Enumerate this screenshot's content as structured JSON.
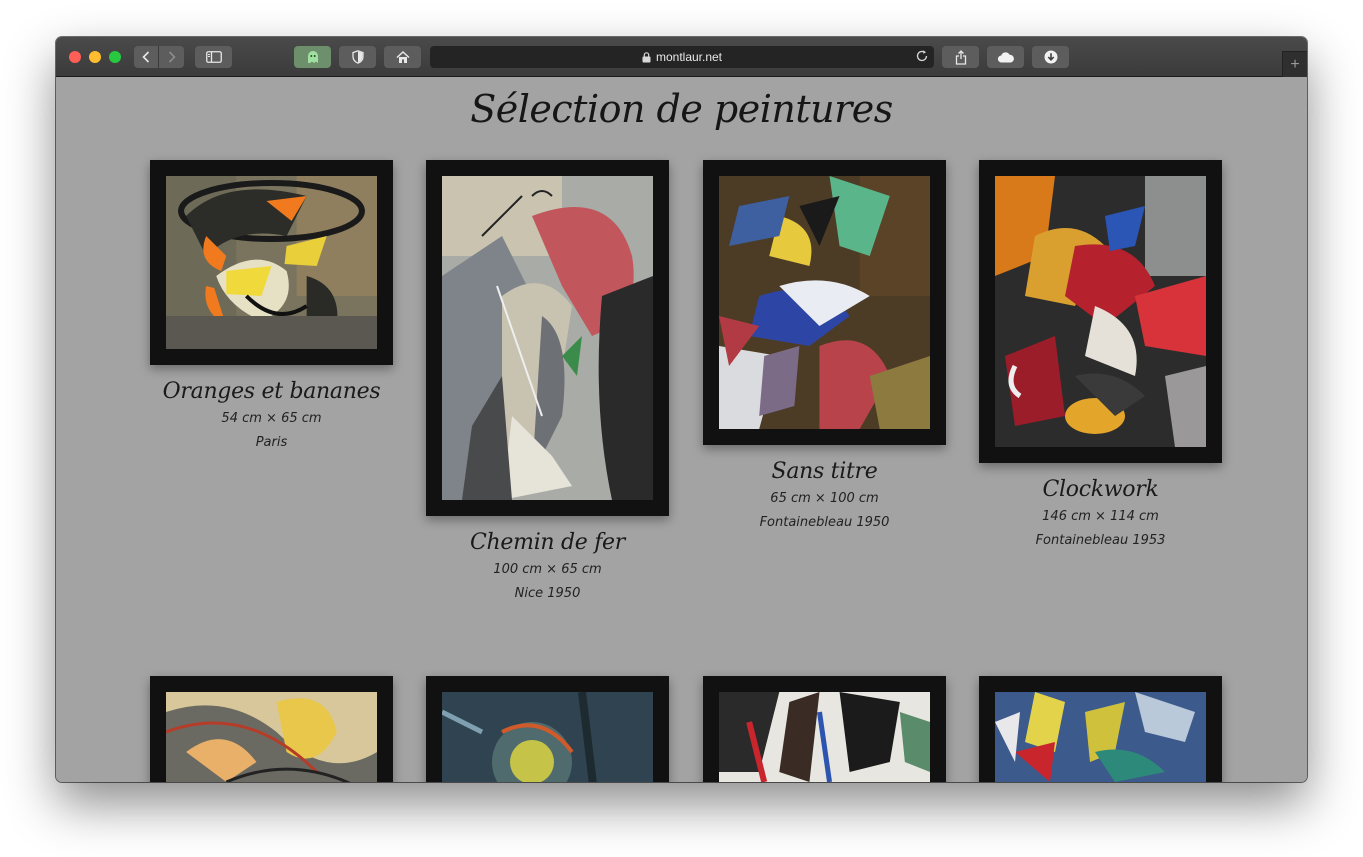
{
  "browser": {
    "url": "montlaur.net",
    "buttons": [
      "back-icon",
      "forward-icon",
      "sidebar-icon",
      "ghost-icon",
      "shield-icon",
      "home-icon",
      "share-icon",
      "cloud-icon",
      "download-icon",
      "new-tab-icon"
    ],
    "new_tab_label": "+"
  },
  "page": {
    "title": "Sélection de peintures",
    "paintings": [
      {
        "title": "Oranges et bananes",
        "dimensions": "54 cm × 65 cm",
        "location": "Paris"
      },
      {
        "title": "Chemin de fer",
        "dimensions": "100 cm × 65 cm",
        "location": "Nice 1950"
      },
      {
        "title": "Sans titre",
        "dimensions": "65 cm × 100 cm",
        "location": "Fontainebleau 1950"
      },
      {
        "title": "Clockwork",
        "dimensions": "146 cm × 114 cm",
        "location": "Fontainebleau 1953"
      }
    ]
  },
  "colors": {
    "page_background": "#a3a3a3",
    "frame": "#111111",
    "toolbar": "#3f3f3f"
  }
}
